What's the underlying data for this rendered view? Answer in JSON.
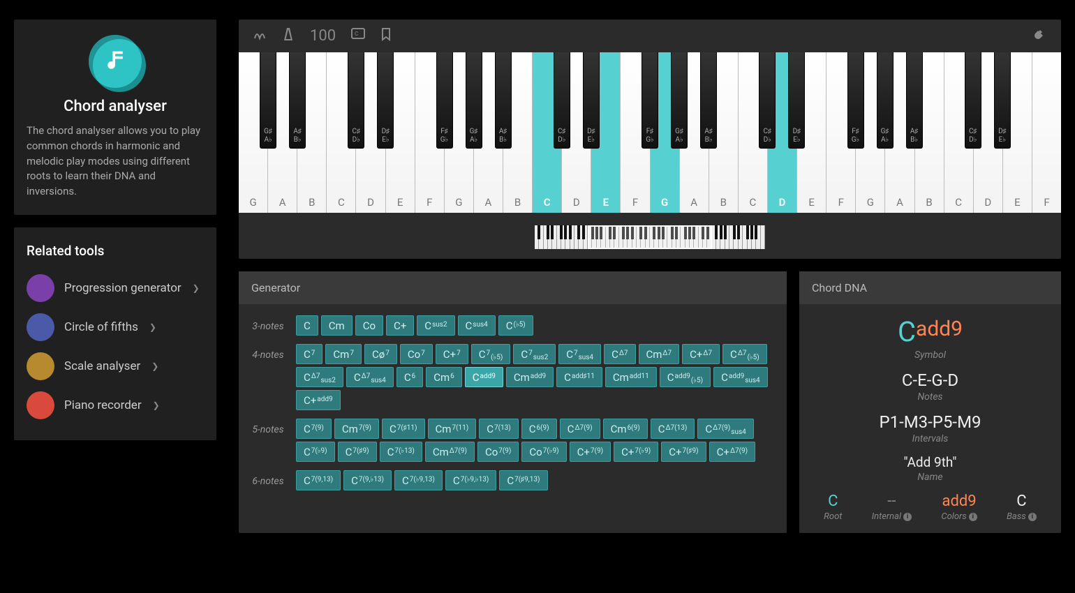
{
  "sidebar": {
    "hero": {
      "title": "Chord analyser",
      "description": "The chord analyser allows you to play common chords in harmonic and melodic play modes using different roots to learn their DNA and inversions."
    },
    "related_title": "Related tools",
    "tools": [
      {
        "label": "Progression generator",
        "icon": "progression",
        "color": "#7a3fa8"
      },
      {
        "label": "Circle of fifths",
        "icon": "circle",
        "color": "#4a5aa8"
      },
      {
        "label": "Scale analyser",
        "icon": "scale",
        "color": "#b78a2f"
      },
      {
        "label": "Piano recorder",
        "icon": "recorder",
        "color": "#d94a3d"
      }
    ]
  },
  "toolbar": {
    "tempo": "100"
  },
  "keyboard": {
    "white_notes": [
      "G",
      "A",
      "B",
      "C",
      "D",
      "E",
      "F",
      "G",
      "A",
      "B",
      "C",
      "D",
      "E",
      "F",
      "G",
      "A",
      "B",
      "C",
      "D",
      "E",
      "F",
      "G",
      "A",
      "B",
      "C",
      "D",
      "E",
      "F"
    ],
    "highlighted_indices": [
      10,
      12,
      14,
      18
    ],
    "black_key_labels": [
      "G♯\nA♭",
      "A♯\nB♭",
      "C♯\nD♭",
      "D♯\nE♭",
      "F♯\nG♭",
      "G♯\nA♭",
      "A♯\nB♭",
      "C♯\nD♭",
      "D♯\nE♭",
      "F♯\nG♭",
      "G♯\nA♭",
      "A♯\nB♭",
      "C♯\nD♭",
      "D♯\nE♭",
      "F♯\nG♭",
      "G♯\nA♭",
      "A♯\nB♭",
      "C♯\nD♭",
      "D♯\nE♭"
    ],
    "mini_total_whites": 52,
    "mini_view_start": 12,
    "mini_view_span": 28
  },
  "generator": {
    "title": "Generator",
    "rows": [
      {
        "label": "3-notes",
        "chords": [
          {
            "r": "C"
          },
          {
            "r": "C",
            "s": "m"
          },
          {
            "r": "C",
            "s": "o"
          },
          {
            "r": "C",
            "s": "+"
          },
          {
            "r": "C",
            "sup": "sus2"
          },
          {
            "r": "C",
            "sup": "sus4"
          },
          {
            "r": "C",
            "sup": "(♭5)"
          }
        ]
      },
      {
        "label": "4-notes",
        "chords": [
          {
            "r": "C",
            "sup": "7"
          },
          {
            "r": "C",
            "s": "m",
            "sup": "7"
          },
          {
            "r": "C",
            "s": "ø",
            "sup": "7"
          },
          {
            "r": "C",
            "s": "o",
            "sup": "7"
          },
          {
            "r": "C",
            "s": "+",
            "sup": "7"
          },
          {
            "r": "C",
            "sup": "7",
            "sub": "(♭5)"
          },
          {
            "r": "C",
            "sup": "7",
            "sub": "sus2"
          },
          {
            "r": "C",
            "sup": "7",
            "sub": "sus4"
          },
          {
            "r": "C",
            "sup": "Δ7"
          },
          {
            "r": "C",
            "s": "m",
            "sup": "Δ7"
          },
          {
            "r": "C",
            "s": "+",
            "sup": "Δ7"
          },
          {
            "r": "C",
            "sup": "Δ7",
            "sub": "(♭5)"
          },
          {
            "r": "C",
            "sup": "Δ7",
            "sub": "sus2"
          },
          {
            "r": "C",
            "sup": "Δ7",
            "sub": "sus4"
          },
          {
            "r": "C",
            "sup": "6"
          },
          {
            "r": "C",
            "s": "m",
            "sup": "6"
          },
          {
            "r": "C",
            "sup": "add9",
            "active": true
          },
          {
            "r": "C",
            "s": "m",
            "sup": "add9"
          },
          {
            "r": "C",
            "sup": "add♯11"
          },
          {
            "r": "C",
            "s": "m",
            "sup": "add11"
          },
          {
            "r": "C",
            "sup": "add9",
            "sub": "(♭5)"
          },
          {
            "r": "C",
            "sup": "add9",
            "sub": "sus4"
          },
          {
            "r": "C",
            "s": "+",
            "sup": "add9"
          }
        ]
      },
      {
        "label": "5-notes",
        "chords": [
          {
            "r": "C",
            "sup": "7(9)"
          },
          {
            "r": "C",
            "s": "m",
            "sup": "7(9)"
          },
          {
            "r": "C",
            "sup": "7(♯11)"
          },
          {
            "r": "C",
            "s": "m",
            "sup": "7(11)"
          },
          {
            "r": "C",
            "sup": "7(13)"
          },
          {
            "r": "C",
            "sup": "6(9)"
          },
          {
            "r": "C",
            "sup": "Δ7(9)"
          },
          {
            "r": "C",
            "s": "m",
            "sup": "6(9)"
          },
          {
            "r": "C",
            "sup": "Δ7(13)"
          },
          {
            "r": "C",
            "sup": "Δ7(9)",
            "sub": "sus4"
          },
          {
            "r": "C",
            "sup": "7(♭9)"
          },
          {
            "r": "C",
            "sup": "7(♯9)"
          },
          {
            "r": "C",
            "sup": "7(♭13)"
          },
          {
            "r": "C",
            "s": "m",
            "sup": "Δ7(9)"
          },
          {
            "r": "C",
            "s": "o",
            "sup": "7(9)"
          },
          {
            "r": "C",
            "s": "o",
            "sup": "7(♭9)"
          },
          {
            "r": "C",
            "s": "+",
            "sup": "7(9)"
          },
          {
            "r": "C",
            "s": "+",
            "sup": "7(♭9)"
          },
          {
            "r": "C",
            "s": "+",
            "sup": "7(♯9)"
          },
          {
            "r": "C",
            "s": "+",
            "sup": "Δ7(9)"
          }
        ]
      },
      {
        "label": "6-notes",
        "chords": [
          {
            "r": "C",
            "sup": "7(9,13)"
          },
          {
            "r": "C",
            "sup": "7(9,♭13)"
          },
          {
            "r": "C",
            "sup": "7(♭9,13)"
          },
          {
            "r": "C",
            "sup": "7(♭9,♭13)"
          },
          {
            "r": "C",
            "sup": "7(♯9,13)"
          }
        ]
      }
    ]
  },
  "dna": {
    "title": "Chord DNA",
    "symbol_root": "C",
    "symbol_ext": "add9",
    "symbol_caption": "Symbol",
    "notes": "C-E-G-D",
    "notes_caption": "Notes",
    "intervals": "P1-M3-P5-M9",
    "intervals_caption": "Intervals",
    "name": "\"Add 9th\"",
    "name_caption": "Name",
    "meta": {
      "root": {
        "val": "C",
        "lbl": "Root"
      },
      "internal": {
        "val": "--",
        "lbl": "Internal"
      },
      "colors": {
        "val": "add9",
        "lbl": "Colors"
      },
      "bass": {
        "val": "C",
        "lbl": "Bass"
      }
    }
  }
}
